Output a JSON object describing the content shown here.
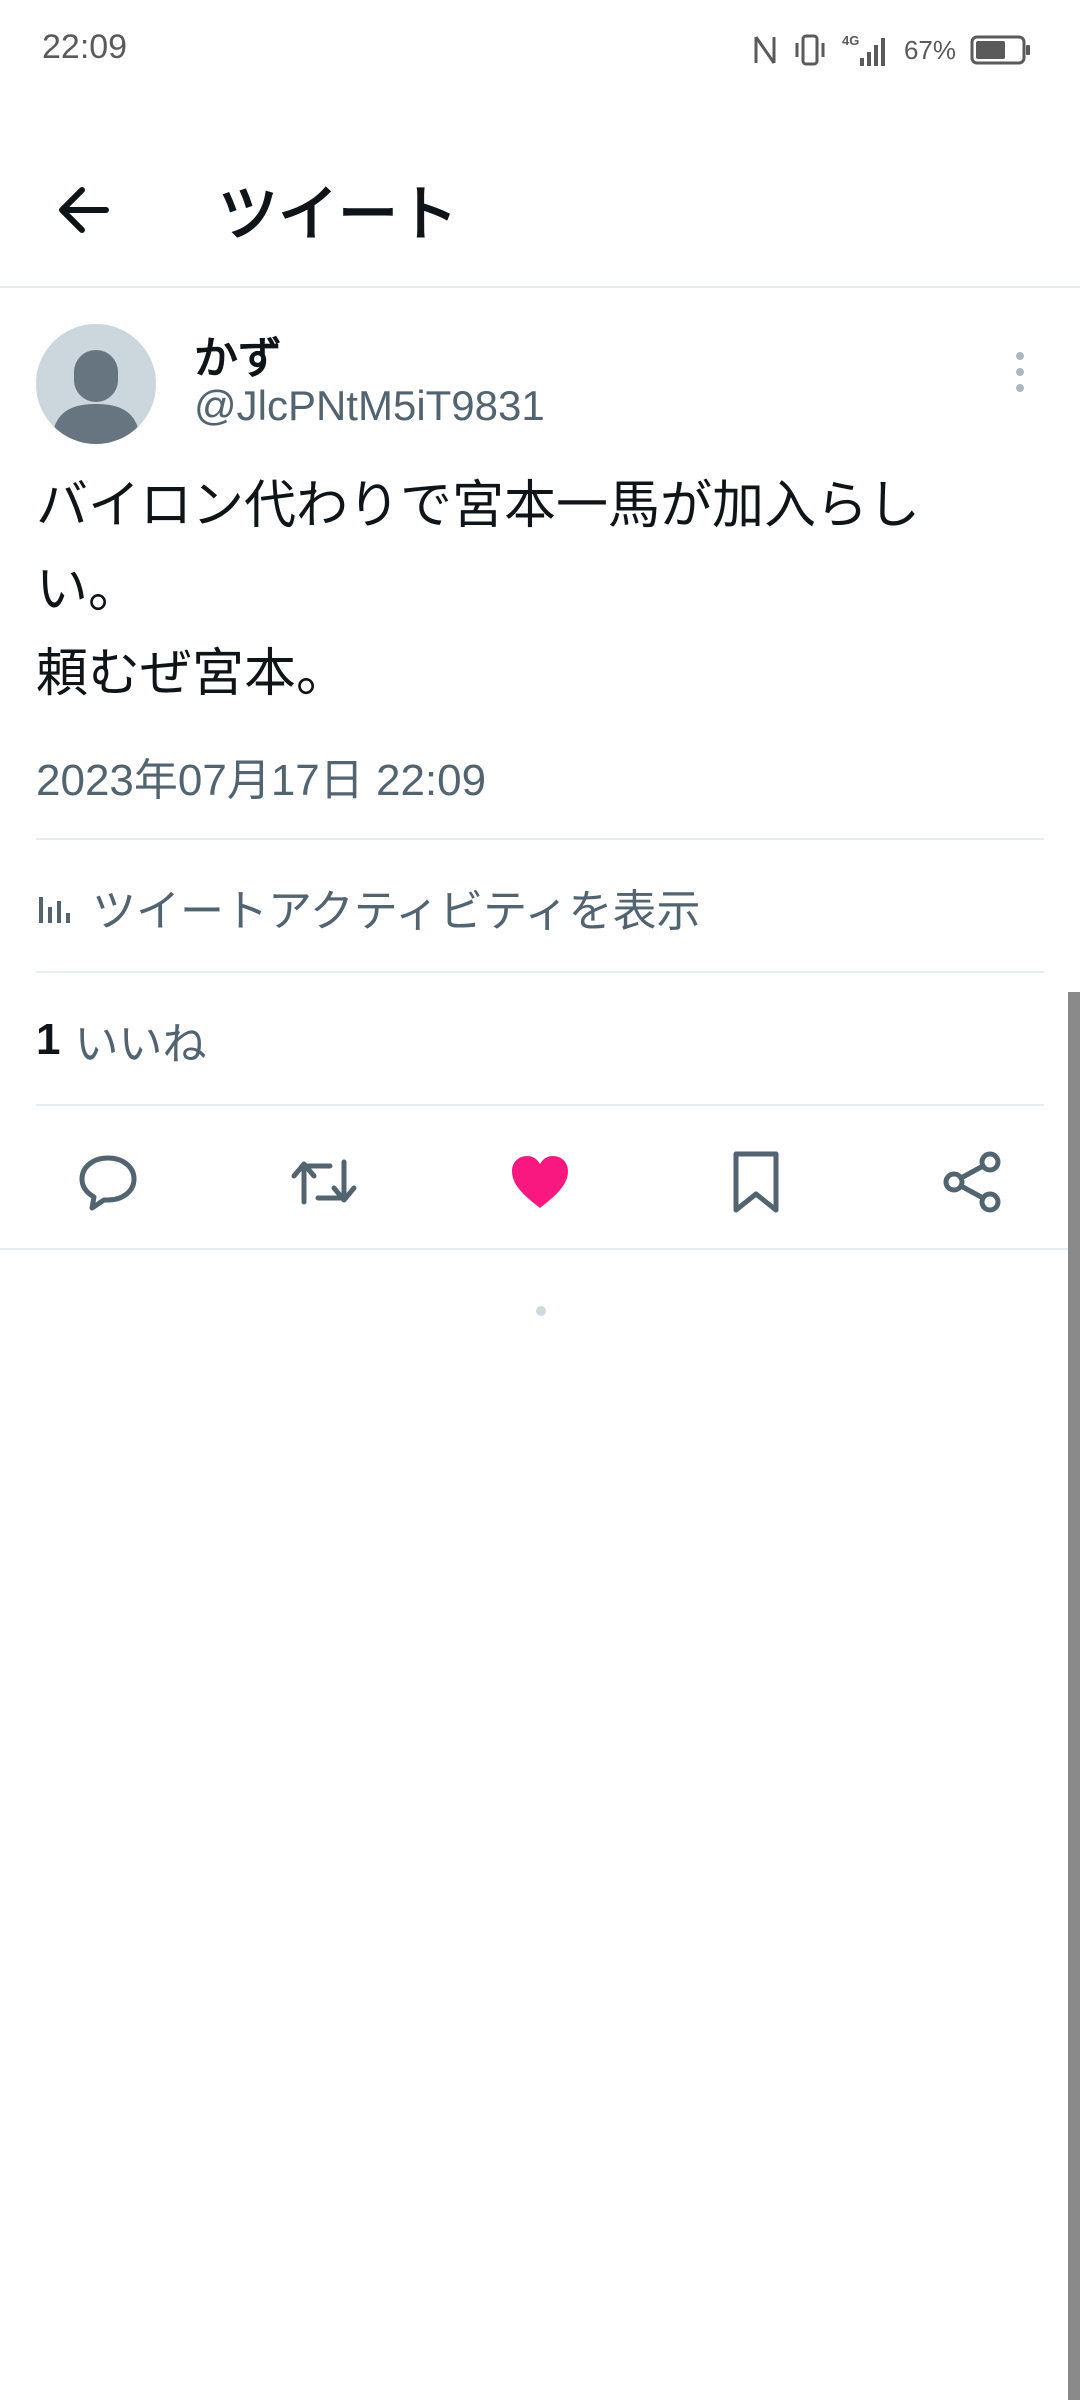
{
  "status_bar": {
    "time": "22:09",
    "network": "4G",
    "battery_percent": "67%",
    "battery_level": 0.67,
    "icons": [
      "nfc-icon",
      "vibrate-icon",
      "signal-4g-icon",
      "battery-icon"
    ]
  },
  "header": {
    "title": "ツイート",
    "back_icon": "arrow-left-icon"
  },
  "tweet": {
    "display_name": "かず",
    "handle": "@JlcPNtM5iT9831",
    "text": "バイロン代わりで宮本一馬が加入らし\nい。\n頼むぜ宮本。",
    "timestamp": "2023年07月17日 22:09",
    "activity_label": "ツイートアクティビティを表示",
    "likes_count": "1",
    "likes_label": "いいね"
  },
  "actions": [
    {
      "name": "reply",
      "icon": "reply-icon"
    },
    {
      "name": "retweet",
      "icon": "retweet-icon"
    },
    {
      "name": "like",
      "icon": "heart-icon",
      "active": true
    },
    {
      "name": "bookmark",
      "icon": "bookmark-icon"
    },
    {
      "name": "share",
      "icon": "share-icon"
    }
  ],
  "colors": {
    "like_active": "#f91880",
    "secondary_text": "#536471",
    "divider": "#e6ecf0"
  }
}
